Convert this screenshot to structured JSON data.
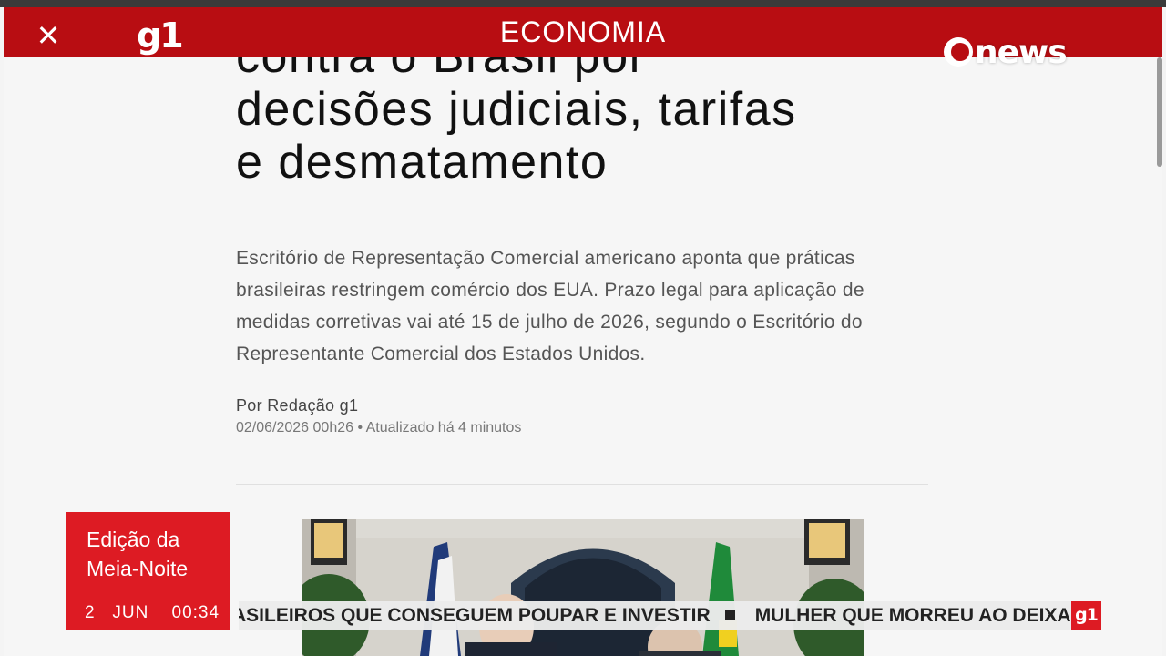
{
  "header": {
    "close_icon": "close-icon",
    "logo": "g1",
    "section": "ECONOMIA"
  },
  "article": {
    "headline_lines": [
      "contra o Brasil por",
      "decisões judiciais, tarifas",
      "e desmatamento"
    ],
    "summary": "Escritório de Representação Comercial americano aponta que práticas brasileiras restringem comércio dos EUA. Prazo legal para aplicação de medidas corretivas vai até 15 de julho de 2026, segundo o Escritório do Representante Comercial dos Estados Unidos.",
    "author": "Por Redação g1",
    "date": "02/06/2026 00h26 • Atualizado há 4 minutos"
  },
  "overlay": {
    "channel_logo": "news",
    "edition_line1": "Edição da",
    "edition_line2": "Meia-Noite",
    "day": "2",
    "month": "JUN",
    "time": "00:34",
    "ticker_item1": "ASILEIROS QUE CONSEGUEM POUPAR E INVESTIR",
    "ticker_item2": "MULHER QUE MORREU AO DEIXAR A",
    "ticker_logo": "g1"
  },
  "colors": {
    "brand_red": "#b80d12",
    "overlay_red": "#dd1b23"
  }
}
